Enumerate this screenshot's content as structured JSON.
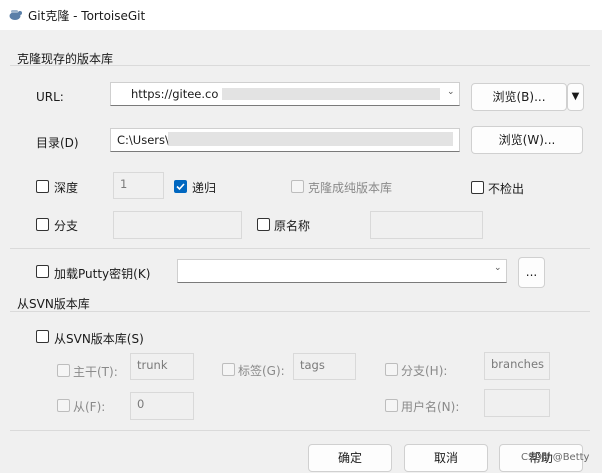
{
  "window": {
    "title": "Git克隆 - TortoiseGit",
    "app_icon": "tortoisegit-icon"
  },
  "clone_group": {
    "title": "克隆现存的版本库",
    "url_label": "URL:",
    "url_value": "https://gitee.co",
    "browse_url_button": "浏览(B)...",
    "dir_label": "目录(D)",
    "dir_value": "C:\\Users\\",
    "browse_dir_button": "浏览(W)...",
    "depth_label": "深度",
    "depth_value": "1",
    "recursive_label": "递归",
    "bare_label": "克隆成纯版本库",
    "no_checkout_label": "不检出",
    "branch_label": "分支",
    "origin_label": "原名称"
  },
  "putty": {
    "label": "加载Putty密钥(K)",
    "browse_button": "..."
  },
  "svn_group": {
    "title": "从SVN版本库",
    "from_svn_label": "从SVN版本库(S)",
    "trunk_label": "主干(T):",
    "trunk_value": "trunk",
    "tags_label": "标签(G):",
    "tags_value": "tags",
    "branch_label": "分支(H):",
    "branch_value": "branches",
    "from_label": "从(F):",
    "from_value": "0",
    "username_label": "用户名(N):"
  },
  "footer": {
    "ok": "确定",
    "cancel": "取消",
    "help": "帮助",
    "watermark": "CSDN @Betty"
  },
  "colors": {
    "accent": "#0067c0",
    "window_bg": "#f0f0f0"
  }
}
